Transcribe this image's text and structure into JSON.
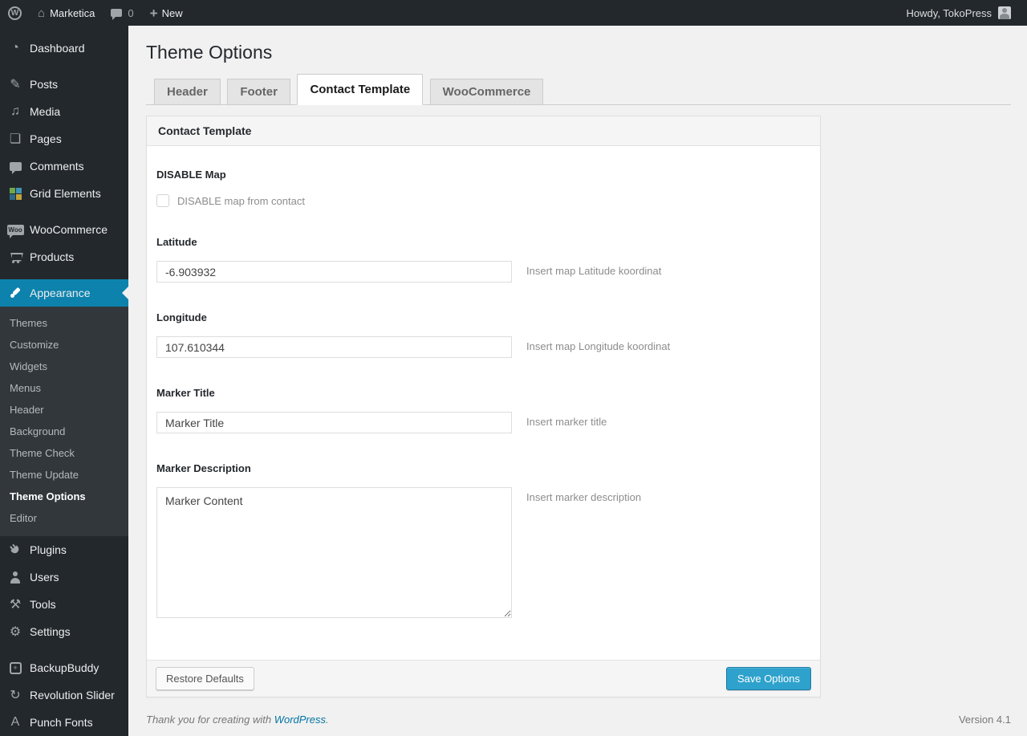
{
  "admin_bar": {
    "site_name": "Marketica",
    "comment_count": "0",
    "new_label": "New",
    "howdy": "Howdy, TokoPress"
  },
  "icons": {
    "wordpress_logo": "W",
    "home": "⌂",
    "plus": "+",
    "dashboard": "◔",
    "posts": "✎",
    "media": "♫",
    "pages": "❏",
    "tools": "⚒",
    "settings": "⚙",
    "backupbuddy": "+",
    "revolution_slider": "↻",
    "punch_fonts": "A",
    "woocommerce_badge": "Woo"
  },
  "sidebar": {
    "items": [
      {
        "label": "Dashboard",
        "icon": "dashboard-icon"
      },
      {
        "label": "Posts",
        "icon": "posts-icon"
      },
      {
        "label": "Media",
        "icon": "media-icon"
      },
      {
        "label": "Pages",
        "icon": "pages-icon"
      },
      {
        "label": "Comments",
        "icon": "comments-bubble-icon"
      },
      {
        "label": "Grid Elements",
        "icon": "grid-elements-icon"
      },
      {
        "label": "WooCommerce",
        "icon": "woocommerce-icon"
      },
      {
        "label": "Products",
        "icon": "cart-icon"
      },
      {
        "label": "Appearance",
        "icon": "appearance-brush-icon",
        "current": true
      },
      {
        "label": "Plugins",
        "icon": "plug-icon"
      },
      {
        "label": "Users",
        "icon": "user-icon"
      },
      {
        "label": "Tools",
        "icon": "tools-icon"
      },
      {
        "label": "Settings",
        "icon": "settings-icon"
      },
      {
        "label": "BackupBuddy",
        "icon": "backupbuddy-icon"
      },
      {
        "label": "Revolution Slider",
        "icon": "revolution-slider-icon"
      },
      {
        "label": "Punch Fonts",
        "icon": "punch-fonts-icon"
      }
    ],
    "appearance_submenu": [
      {
        "label": "Themes"
      },
      {
        "label": "Customize"
      },
      {
        "label": "Widgets"
      },
      {
        "label": "Menus"
      },
      {
        "label": "Header"
      },
      {
        "label": "Background"
      },
      {
        "label": "Theme Check"
      },
      {
        "label": "Theme Update"
      },
      {
        "label": "Theme Options",
        "current": true
      },
      {
        "label": "Editor"
      }
    ]
  },
  "main": {
    "title": "Theme Options",
    "tabs": [
      {
        "label": "Header",
        "active": false
      },
      {
        "label": "Footer",
        "active": false
      },
      {
        "label": "Contact Template",
        "active": true
      },
      {
        "label": "WooCommerce",
        "active": false
      }
    ],
    "panel": {
      "header": "Contact Template",
      "fields": {
        "disable_map": {
          "label": "DISABLE Map",
          "checkbox_label": "DISABLE map from contact",
          "checked": false
        },
        "latitude": {
          "label": "Latitude",
          "value": "-6.903932",
          "help": "Insert map Latitude koordinat"
        },
        "longitude": {
          "label": "Longitude",
          "value": "107.610344",
          "help": "Insert map Longitude koordinat"
        },
        "marker_title": {
          "label": "Marker Title",
          "value": "Marker Title",
          "help": "Insert marker title"
        },
        "marker_description": {
          "label": "Marker Description",
          "value": "Marker Content",
          "help": "Insert marker description"
        }
      },
      "footer": {
        "restore_label": "Restore Defaults",
        "save_label": "Save Options"
      }
    }
  },
  "page_footer": {
    "thanks_prefix": "Thank you for creating with",
    "wordpress_link": "WordPress",
    "thanks_suffix": ".",
    "version": "Version 4.1"
  },
  "colors": {
    "adminbar_bg": "#23282d",
    "sidebar_bg": "#23282d",
    "submenu_bg": "#32373c",
    "menu_highlight": "#0d82ad",
    "primary_button": "#2ea2cc",
    "link_blue": "#0074a2",
    "content_bg": "#f1f1f1"
  }
}
